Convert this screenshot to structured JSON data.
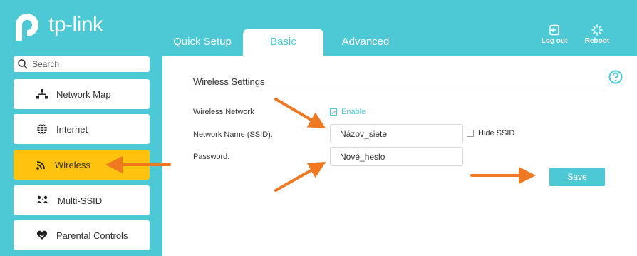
{
  "brand": {
    "logo_text": "tp-link"
  },
  "tabs": [
    {
      "label": "Quick Setup"
    },
    {
      "label": "Basic"
    },
    {
      "label": "Advanced"
    }
  ],
  "header_actions": {
    "logout": "Log out",
    "reboot": "Reboot"
  },
  "search": {
    "placeholder": "Search"
  },
  "sidebar": {
    "items": [
      {
        "label": "Network Map",
        "icon": "network-map-icon"
      },
      {
        "label": "Internet",
        "icon": "globe-icon"
      },
      {
        "label": "Wireless",
        "icon": "wifi-icon",
        "active": true
      },
      {
        "label": "Multi-SSID",
        "icon": "users-icon"
      },
      {
        "label": "Parental Controls",
        "icon": "heart-icon"
      }
    ]
  },
  "wireless": {
    "section_title": "Wireless Settings",
    "network_label": "Wireless Network",
    "enable_label": "Enable",
    "enable_checked": true,
    "ssid_label": "Network Name (SSID):",
    "ssid_value": "Názov_siete",
    "hide_ssid_label": "Hide SSID",
    "hide_ssid_checked": false,
    "password_label": "Password:",
    "password_value": "Nové_heslo",
    "save_label": "Save"
  },
  "colors": {
    "accent": "#4dc9d6",
    "active_nav": "#ffc20e",
    "arrow": "#f07820"
  }
}
